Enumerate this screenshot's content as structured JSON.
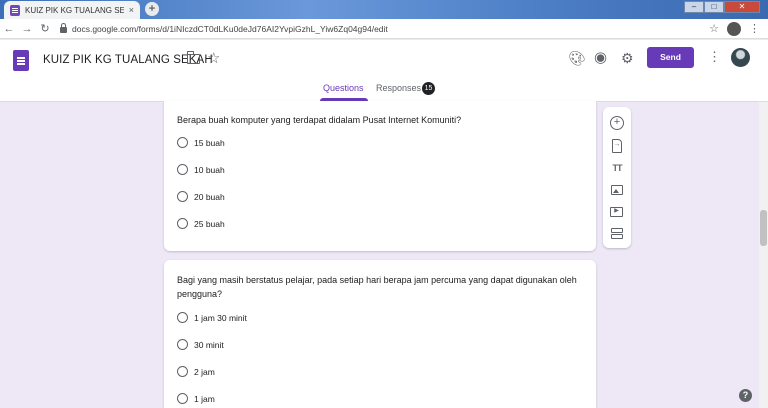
{
  "browser": {
    "tab_title": "KUIZ PIK KG TUALANG SEKAH - G",
    "tab_close": "×",
    "new_tab": "+",
    "url": "docs.google.com/forms/d/1iNIczdCT0dLKu0deJd76AI2YvpiGzhL_Yiw6Zq04g94/edit"
  },
  "header": {
    "form_title": "KUIZ PIK KG TUALANG SEKAH",
    "send_label": "Send",
    "tabs": {
      "questions": "Questions",
      "responses": "Responses",
      "responses_count": "15"
    }
  },
  "questions": [
    {
      "text": "Berapa buah komputer yang terdapat didalam Pusat Internet Komuniti?",
      "options": [
        "15 buah",
        "10 buah",
        "20 buah",
        "25 buah"
      ]
    },
    {
      "text": "Bagi yang masih berstatus pelajar, pada setiap hari berapa jam percuma yang dapat digunakan oleh pengguna?",
      "options": [
        "1 jam 30 minit",
        "30 minit",
        "2 jam",
        "1 jam"
      ]
    }
  ],
  "help": "?",
  "colors": {
    "accent": "#673ab7",
    "background": "#ede7f6"
  }
}
